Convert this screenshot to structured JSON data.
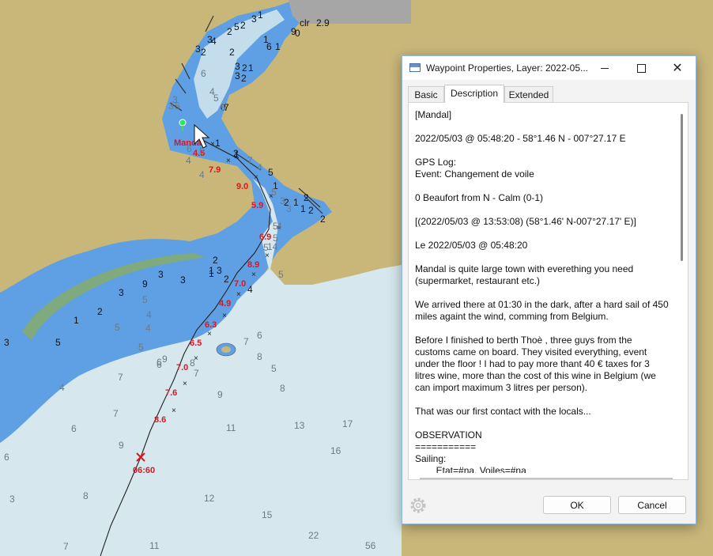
{
  "chart": {
    "speeds": [
      "4.5",
      "7.9",
      "9.0",
      "5.9",
      "6.9",
      "8.9",
      "7.0",
      "4.9",
      "6.3",
      "6.5",
      "7.0",
      "7.6",
      "8.6"
    ],
    "waypoint_label": "Mandal",
    "time_label": "06:60",
    "clr_label": "clr",
    "clr_value": "2.9",
    "depths_dark": [
      "3",
      "2",
      "3",
      "4",
      "2",
      "5",
      "2",
      "3",
      "1",
      "2",
      "3",
      "2",
      "1",
      "3",
      "2",
      "0",
      "7",
      "1",
      "6",
      "1",
      "0",
      "9",
      "3",
      "3",
      "2",
      "3",
      "1",
      "9",
      "2",
      "1",
      "1",
      "2",
      "1",
      "5",
      "1",
      "2",
      "2",
      "1",
      "2",
      "1",
      "2",
      "4",
      "2",
      "3",
      "1",
      "5",
      "3"
    ],
    "depths_light": [
      "6",
      "4",
      "3",
      "5",
      "3",
      "6",
      "4",
      "5",
      "7",
      "4",
      "5",
      "3",
      "3",
      "4",
      "5",
      "5",
      "7",
      "6",
      "5",
      "4",
      "5",
      "4",
      "5",
      "6",
      "6",
      "9",
      "8",
      "5",
      "7",
      "8",
      "7",
      "9",
      "8",
      "7",
      "6",
      "11",
      "13",
      "17",
      "16",
      "6",
      "8",
      "12",
      "15",
      "22",
      "11",
      "7",
      "56",
      "3",
      "4",
      "9",
      "5",
      "14",
      "5",
      "4",
      "5",
      "5"
    ]
  },
  "dialog": {
    "title": "Waypoint Properties, Layer: 2022-05...",
    "minimize_icon": "minimize-icon",
    "maximize_icon": "maximize-icon",
    "close_icon": "close-icon",
    "tabs": [
      {
        "label": "Basic"
      },
      {
        "label": "Description"
      },
      {
        "label": "Extended"
      }
    ],
    "description": [
      "[Mandal]",
      "2022/05/03 @ 05:48:20 - 58°1.46 N - 007°27.17 E",
      "GPS Log:\nEvent: Changement de voile",
      "0 Beaufort from N - Calm (0-1)",
      "[(2022/05/03 @ 13:53:08) (58°1.46' N-007°27.17' E)]",
      "Le 2022/05/03 @ 05:48:20",
      "Mandal is quite large town with everething you need (supermarket, restaurant etc.)",
      "We arrived there at 01:30 in the dark, after a hard sail of 450 miles againt the wind, comming from Belgium.",
      "Before I finished to berth Thoè , three guys from the customs came on board. They visited everything, event under the floor ! I had to pay more thant 40 € taxes for 3 litres wine, more than the cost of this wine in Belgium (we can import maximum 3 litres per person).",
      "That was our first contact with the locals...",
      "OBSERVATION\n===========\nSailing:\n        Etat=#na, Voiles=#na"
    ],
    "ok_label": "OK",
    "cancel_label": "Cancel",
    "settings_icon": "gear-icon"
  }
}
